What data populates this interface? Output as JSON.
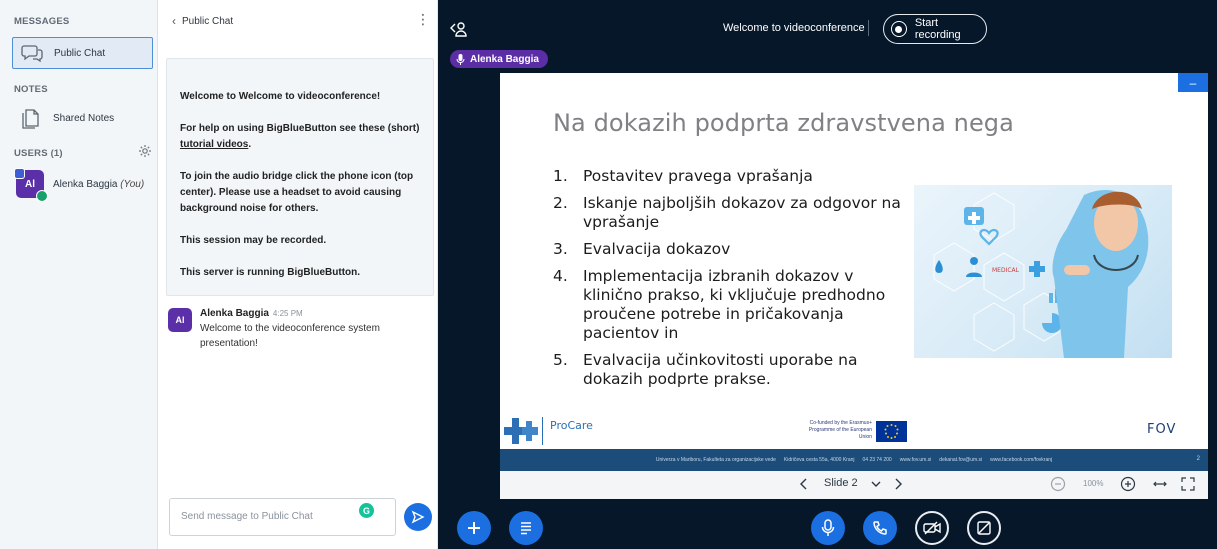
{
  "sidebar": {
    "messages_title": "MESSAGES",
    "public_chat_label": "Public Chat",
    "notes_title": "NOTES",
    "shared_notes_label": "Shared Notes",
    "users_title": "USERS (1)",
    "user": {
      "initials": "Al",
      "name": "Alenka Baggia",
      "you_suffix": "(You)"
    }
  },
  "chat": {
    "header_label": "Public Chat",
    "welcome": {
      "line1_prefix": "Welcome to ",
      "line1_bold": "Welcome to videoconference",
      "line1_suffix": "!",
      "line2_prefix": "For help on using BigBlueButton see these (short) ",
      "line2_link": "tutorial videos",
      "line2_suffix": ".",
      "line3": "To join the audio bridge click the phone icon (top center). Please use a headset to avoid causing background noise for others.",
      "line4": "This session may be recorded.",
      "line5": "This server is running BigBlueButton."
    },
    "message": {
      "avatar_initials": "Al",
      "author": "Alenka Baggia",
      "time": "4:25 PM",
      "text": "Welcome to the videoconference system presentation!"
    },
    "input_placeholder": "Send message to Public Chat",
    "grammarly_letter": "G"
  },
  "topbar": {
    "meeting_title": "Welcome to videoconference",
    "record_label": "Start recording",
    "talker_name": "Alenka Baggia"
  },
  "slide": {
    "title": "Na dokazih podprta zdravstvena nega",
    "items": [
      {
        "n": "1.",
        "text": "Postavitev pravega vprašanja"
      },
      {
        "n": "2.",
        "text": "Iskanje najboljših dokazov za odgovor na vprašanje"
      },
      {
        "n": "3.",
        "text": "Evalvacija dokazov"
      },
      {
        "n": "4.",
        "text": "Implementacija izbranih dokazov v klinično prakso, ki vključuje predhodno proučene potrebe in pričakovanja  pacientov in"
      },
      {
        "n": "5.",
        "text": "Evalvacija učinkovitosti uporabe na dokazih podprte prakse."
      }
    ],
    "image_label": "MEDICAL",
    "procare_name": "ProCare",
    "eu_text": "Co-funded by the Erasmus+ Programme of the European Union",
    "fov_text": "FOV",
    "band_segments": [
      "Univerza v Mariboru, Fakulteta za organizacijske vede",
      "Kidričeva cesta 55a, 4000 Kranj",
      "04 23 74 200",
      "www.fov.um.si",
      "dekanat.fov@um.si",
      "www.facebook.com/fovkranj"
    ],
    "page_number": "2"
  },
  "slide_controls": {
    "slide_label": "Slide 2",
    "zoom_value": "100%"
  },
  "colors": {
    "accent_blue": "#1b6fe0",
    "main_bg": "#06172a",
    "avatar_purple": "#5a2fa8",
    "talker_purple": "#5b2ea5"
  }
}
